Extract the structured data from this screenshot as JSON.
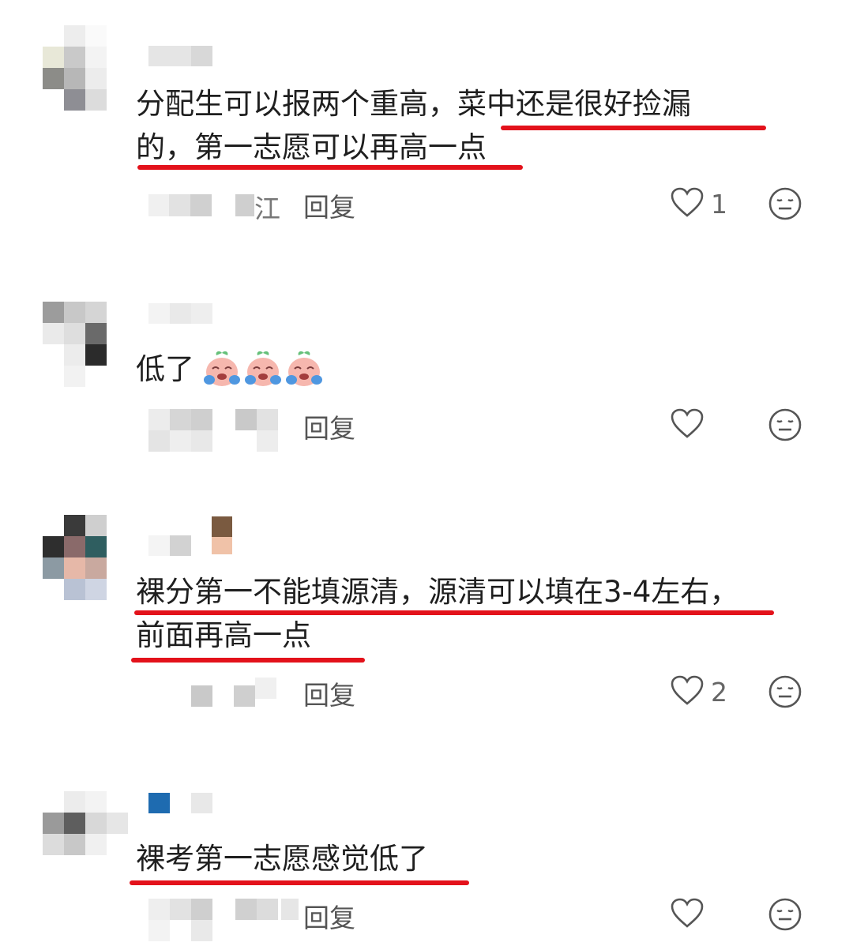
{
  "comments": [
    {
      "location": "江",
      "text_line1_plain": "分配生可以报两个重高，",
      "text_line1_marked": "菜中还是很好捡漏",
      "text_line2_marked": "的，第一志愿可以再高一点",
      "reply_label": "回复",
      "like_count": "1"
    },
    {
      "text": "低了",
      "emoji_name": "crying-face-emoji",
      "emoji_count": 3,
      "reply_label": "回复",
      "like_count": ""
    },
    {
      "text_line1": "裸分第一不能填源清，源清可以填在3-4左右，",
      "text_line2": "前面再高一点",
      "reply_label": "回复",
      "like_count": "2"
    },
    {
      "text": "裸考第一志愿感觉低了",
      "reply_label": "回复",
      "like_count": ""
    }
  ],
  "colors": {
    "underline": "#e3121b",
    "text": "#1f1f1f",
    "meta": "#777777"
  },
  "icons": {
    "like": "heart-outline-icon",
    "dislike": "neutral-face-icon"
  }
}
